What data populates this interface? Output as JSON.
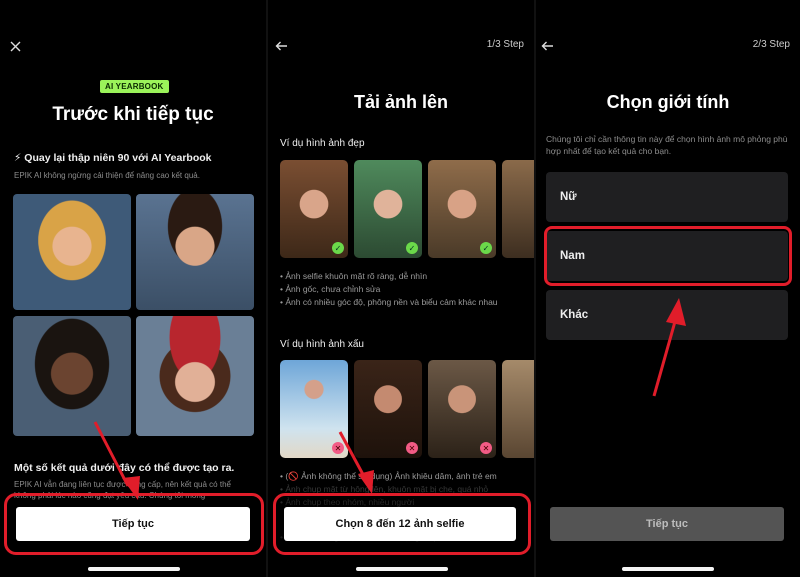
{
  "panel1": {
    "close_icon": "close-icon",
    "badge": "AI YEARBOOK",
    "title": "Trước khi tiếp tục",
    "headline": "⚡ Quay lại thập niên 90 với AI Yearbook",
    "desc": "EPIK AI không ngừng cải thiện để nâng cao kết quả.",
    "results_title": "Một số kết quả dưới đây có thể được tạo ra.",
    "results_desc": "EPIK AI vẫn đang liên tục được nâng cấp, nên kết quả có thể không phải lúc nào cũng đạt yêu cầu. Chúng tôi mong",
    "button": "Tiếp tục"
  },
  "panel2": {
    "back_icon": "back-arrow-icon",
    "step": "1/3 Step",
    "title": "Tải ảnh lên",
    "good_title": "Ví dụ hình ảnh đẹp",
    "good_bullets": [
      "• Ảnh selfie khuôn mặt rõ ràng, dễ nhìn",
      "• Ảnh gốc, chưa chỉnh sửa",
      "• Ảnh có nhiều góc độ, phông nền và biểu cảm khác nhau"
    ],
    "bad_title": "Ví dụ hình ảnh xấu",
    "bad_note": "• (🚫 Ảnh không thể sử dụng) Ảnh khiêu dâm, ảnh trẻ em",
    "bad_bullets_faded": [
      "• Ảnh chụp mặt từ hông lên, khuôn mặt bị che, quá nhỏ",
      "• Ảnh chụp theo nhóm, nhiều người",
      "• Ảnh đen trắng hoặc ảnh chất lượng thấp"
    ],
    "button": "Chọn 8 đến 12 ảnh selfie"
  },
  "panel3": {
    "back_icon": "back-arrow-icon",
    "step": "2/3 Step",
    "title": "Chọn giới tính",
    "desc": "Chúng tôi chỉ cần thông tin này để chọn hình ảnh mô phỏng phù hợp nhất để tạo kết quả cho bạn.",
    "options": [
      "Nữ",
      "Nam",
      "Khác"
    ],
    "button": "Tiếp tục"
  },
  "colors": {
    "accent_red": "#e11d2a",
    "badge_green": "#9bf35a",
    "check_green": "#6bd94a",
    "reject_pink": "#f25b85"
  }
}
